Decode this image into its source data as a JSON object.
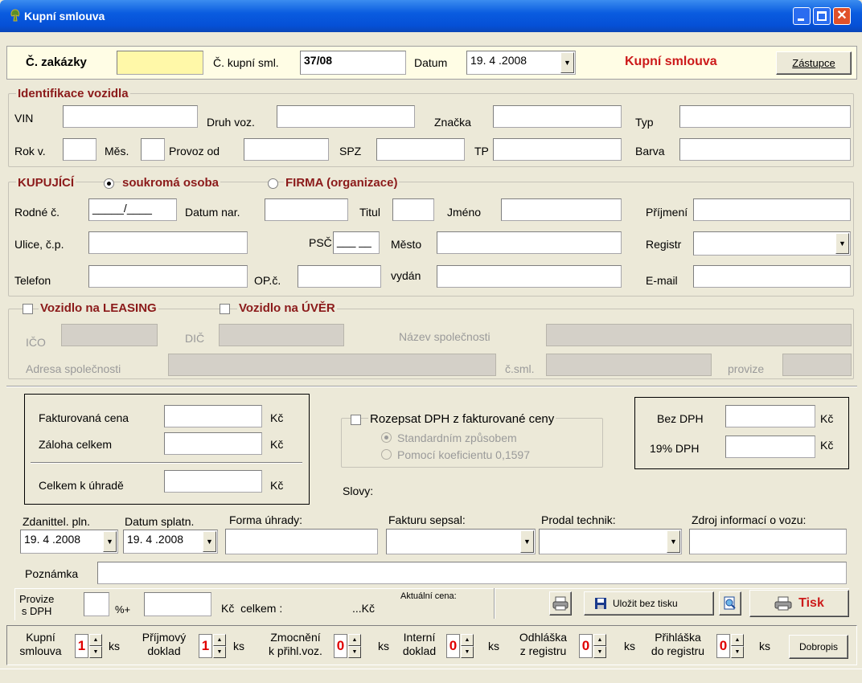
{
  "window": {
    "title": "Kupní smlouva"
  },
  "top": {
    "zakazka_label": "Č. zakázky",
    "zakazka_value": "",
    "kupni_sml_label": "Č. kupní sml.",
    "kupni_sml_value": "37/08",
    "datum_label": "Datum",
    "datum_value": "19. 4 .2008",
    "form_title": "Kupní smlouva",
    "zastupce_button": "Zástupce"
  },
  "vehicle": {
    "section_title": "Identifikace vozidla",
    "vin": "VIN",
    "druh": "Druh voz.",
    "znacka": "Značka",
    "typ": "Typ",
    "rok": "Rok v.",
    "mes": "Měs.",
    "provoz": "Provoz od",
    "spz": "SPZ",
    "tp": "TP",
    "barva": "Barva"
  },
  "buyer": {
    "section_title": "KUPUJÍCÍ",
    "opt_person": "soukromá osoba",
    "opt_company": "FIRMA (organizace)",
    "rodne": "Rodné č.",
    "rodne_value": "_____/____",
    "datum_nar": "Datum nar.",
    "titul": "Titul",
    "jmeno": "Jméno",
    "prijmeni": "Příjmení",
    "ulice": "Ulice, č.p.",
    "psc": "PSČ",
    "psc_value": "___ __",
    "mesto": "Město",
    "registr": "Registr",
    "telefon": "Telefon",
    "op": "OP.č.",
    "vydan": "vydán",
    "email": "E-mail"
  },
  "leasing": {
    "leasing_label": "Vozidlo na LEASING",
    "uver_label": "Vozidlo na ÚVĚR",
    "ico": "IČO",
    "dic": "DIČ",
    "nazev": "Název společnosti",
    "adresa": "Adresa společnosti",
    "csml": "č.sml.",
    "provize": "provize"
  },
  "price": {
    "fakturovana": "Fakturovaná cena",
    "zaloha": "Záloha celkem",
    "celkem": "Celkem k úhradě",
    "kc": "Kč",
    "rozepsat": "Rozepsat DPH z fakturované ceny",
    "standard": "Standardním způsobem",
    "koef": "Pomocí koeficientu 0,1597",
    "bez_dph": "Bez DPH",
    "dph19": "19% DPH",
    "slovy": "Slovy:"
  },
  "payment": {
    "zdanitel": "Zdanittel. pln.",
    "zdanitel_value": "19. 4 .2008",
    "splatn": "Datum splatn.",
    "splatn_value": "19. 4 .2008",
    "forma": "Forma úhrady:",
    "fakturu": "Fakturu sepsal:",
    "prodal": "Prodal technik:",
    "zdroj": "Zdroj informací o vozu:",
    "poznamka": "Poznámka"
  },
  "commission": {
    "provize_l1": "Provize",
    "provize_l2": "s DPH",
    "pct": "%+",
    "kc_celkem": "Kč  celkem :",
    "kc_suffix": "...Kč",
    "aktualni": "Aktuální cena:",
    "ulozit": "Uložit bez tisku",
    "tisk": "Tisk"
  },
  "docs": {
    "ks": "ks",
    "items": [
      {
        "l1": "Kupní",
        "l2": "smlouva",
        "value": "1"
      },
      {
        "l1": "Příjmový",
        "l2": "doklad",
        "value": "1"
      },
      {
        "l1": "Zmocnění",
        "l2": "k přihl.voz.",
        "value": "0"
      },
      {
        "l1": "Interní",
        "l2": "doklad",
        "value": "0"
      },
      {
        "l1": "Odhláška",
        "l2": "z registru",
        "value": "0"
      },
      {
        "l1": "Přihláška",
        "l2": "do registru",
        "value": "0"
      }
    ],
    "dobropis": "Dobropis"
  }
}
